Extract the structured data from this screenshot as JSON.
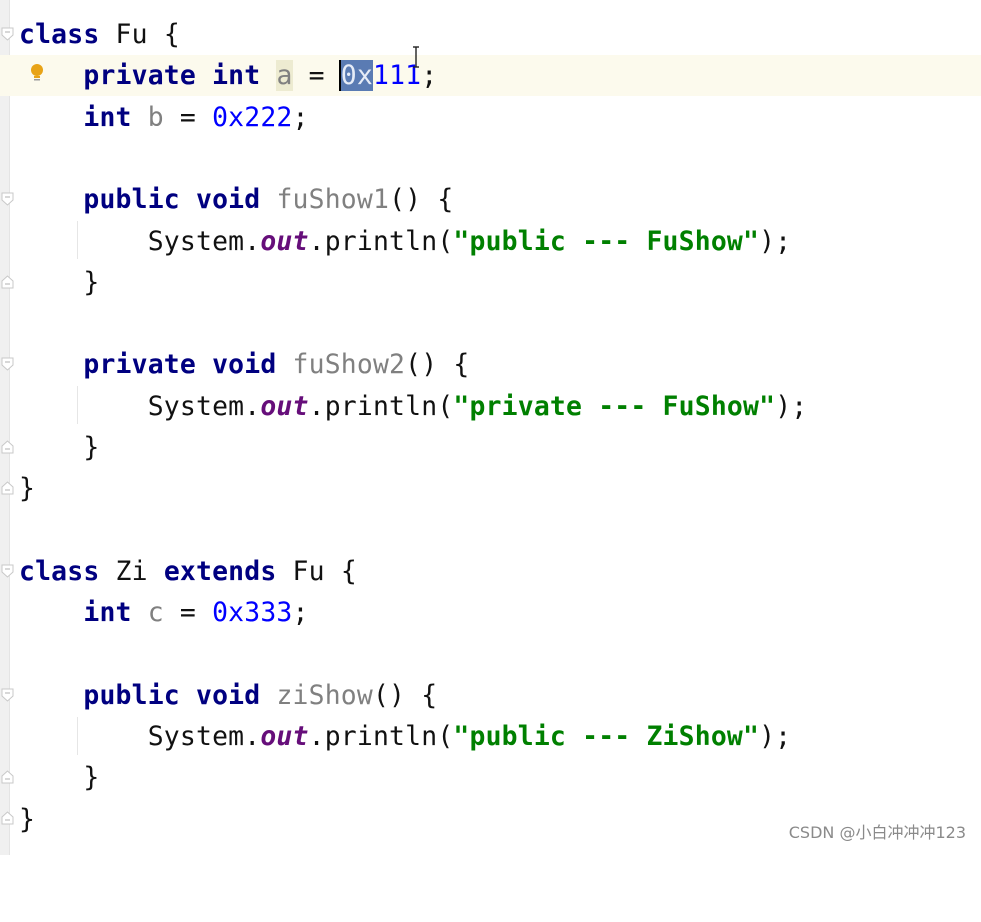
{
  "editor": {
    "language": "java",
    "lines": [
      {
        "kw1": "class",
        "name": "Fu",
        "rest": " {"
      },
      {
        "kw1": "private",
        "kw2": "int",
        "var": "a",
        "eq": " = ",
        "sel": "0x",
        "num": "111",
        "end": ";"
      },
      {
        "kw1": "int",
        "var": "b",
        "eq": " = ",
        "num": "0x222",
        "end": ";"
      },
      {},
      {
        "kw1": "public",
        "kw2": "void",
        "method": "fuShow1",
        "rest": "() {"
      },
      {
        "obj": "System.",
        "field": "out",
        "call": ".println(",
        "str": "\"public --- FuShow\"",
        "end": ");"
      },
      {
        "rest": "}"
      },
      {},
      {
        "kw1": "private",
        "kw2": "void",
        "method": "fuShow2",
        "rest": "() {"
      },
      {
        "obj": "System.",
        "field": "out",
        "call": ".println(",
        "str": "\"private --- FuShow\"",
        "end": ");"
      },
      {
        "rest": "}"
      },
      {
        "rest": "}"
      },
      {},
      {
        "kw1": "class",
        "name": "Zi",
        "kw2": "extends",
        "name2": "Fu",
        "rest": " {"
      },
      {
        "kw1": "int",
        "var": "c",
        "eq": " = ",
        "num": "0x333",
        "end": ";"
      },
      {},
      {
        "kw1": "public",
        "kw2": "void",
        "method": "ziShow",
        "rest": "() {"
      },
      {
        "obj": "System.",
        "field": "out",
        "call": ".println(",
        "str": "\"public --- ZiShow\"",
        "end": ");"
      },
      {
        "rest": "}"
      },
      {
        "rest": "}"
      }
    ],
    "indent": "    ",
    "intention_icon": "lightbulb-icon",
    "fold_icon": "fold-marker-icon",
    "cursor_icon": "text-cursor-icon"
  },
  "colors": {
    "keyword": "#000080",
    "number": "#0000ff",
    "string": "#008000",
    "field": "#660e7a",
    "unused": "#808080",
    "selection": "#5a7bb3",
    "current_line": "#fcfaed",
    "bulb": "#e8a317"
  },
  "watermark": "CSDN @小白冲冲冲123"
}
